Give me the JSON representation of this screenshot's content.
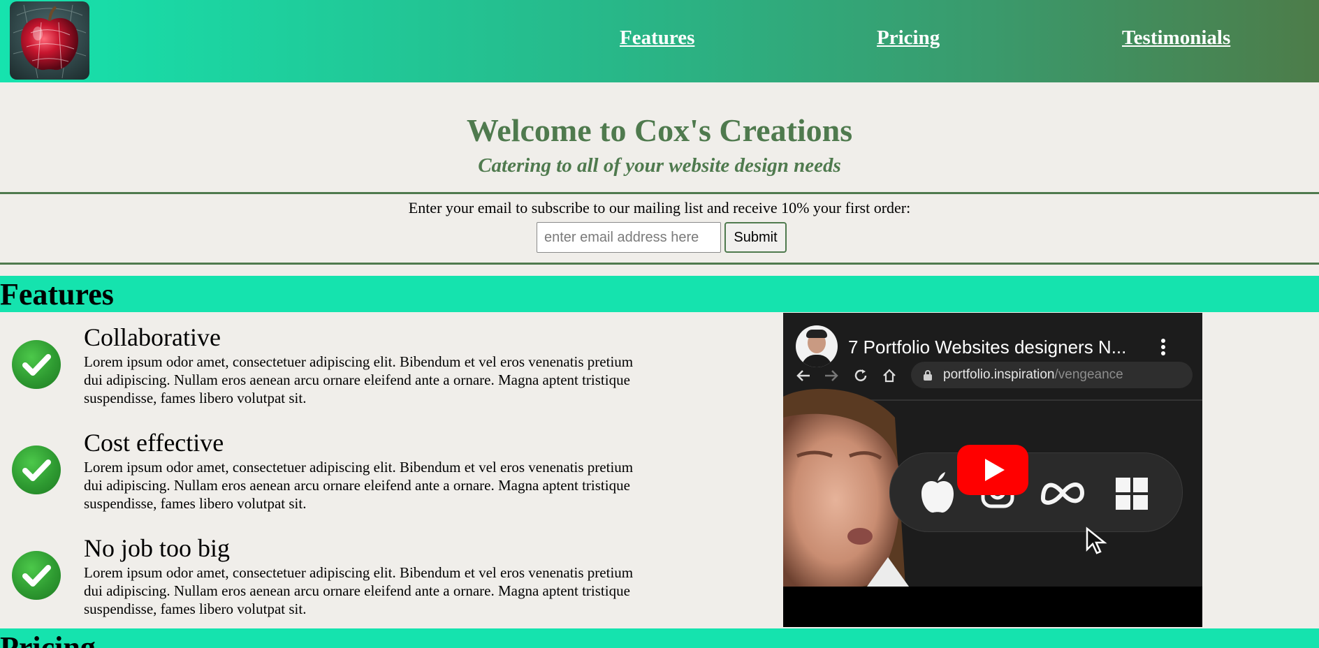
{
  "nav": {
    "links": [
      "Features",
      "Pricing",
      "Testimonials"
    ]
  },
  "hero": {
    "title": "Welcome to Cox's Creations",
    "subtitle": "Catering to all of your website design needs"
  },
  "subscribe": {
    "prompt": "Enter your email to subscribe to our mailing list and receive 10% your first order:",
    "placeholder": "enter email address here",
    "button_label": "Submit"
  },
  "features": {
    "heading": "Features",
    "items": [
      {
        "title": "Collaborative",
        "description": "Lorem ipsum odor amet, consectetuer adipiscing elit. Bibendum et vel eros venenatis pretium dui adipiscing. Nullam eros aenean arcu ornare eleifend ante a ornare. Magna aptent tristique suspendisse, fames libero volutpat sit."
      },
      {
        "title": "Cost effective",
        "description": "Lorem ipsum odor amet, consectetuer adipiscing elit. Bibendum et vel eros venenatis pretium dui adipiscing. Nullam eros aenean arcu ornare eleifend ante a ornare. Magna aptent tristique suspendisse, fames libero volutpat sit."
      },
      {
        "title": "No job too big",
        "description": "Lorem ipsum odor amet, consectetuer adipiscing elit. Bibendum et vel eros venenatis pretium dui adipiscing. Nullam eros aenean arcu ornare eleifend ante a ornare. Magna aptent tristique suspendisse, fames libero volutpat sit."
      }
    ],
    "icon": "checkmark-icon"
  },
  "video": {
    "title": "7 Portfolio Websites designers N...",
    "url_host": "portfolio.inspiration",
    "url_path": "/vengeance",
    "icons": [
      "channel-avatar-icon",
      "more-options-icon",
      "back-icon",
      "forward-icon",
      "reload-icon",
      "home-icon",
      "lock-icon",
      "play-button-icon",
      "apple-icon",
      "instagram-icon",
      "meta-icon",
      "windows-icon",
      "cursor-icon"
    ]
  },
  "pricing": {
    "heading": "Pricing"
  },
  "colors": {
    "header_gradient_start": "#16e3ae",
    "header_gradient_end": "#4d7c49",
    "section_bar": "#15e3ae",
    "accent_green": "#4f7a4e",
    "page_background": "#f0eeea",
    "youtube_red": "#ff0000"
  }
}
